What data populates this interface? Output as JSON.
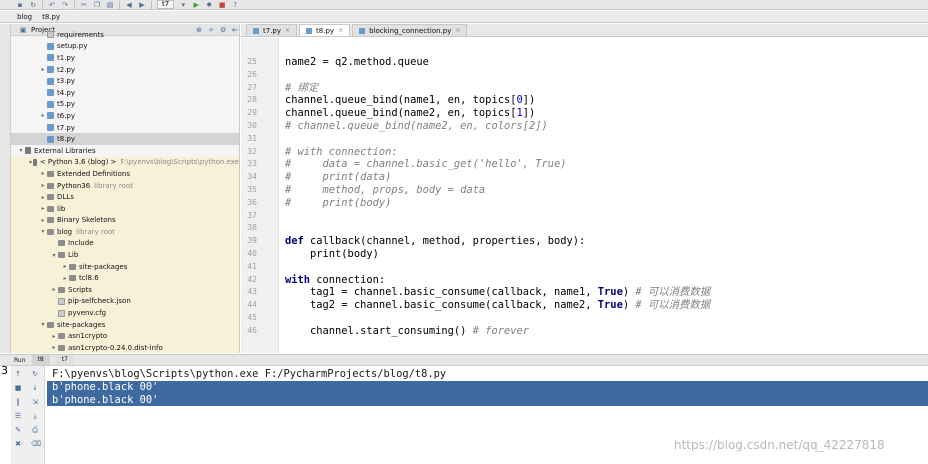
{
  "toolbar": {
    "icons": [
      "save-icon",
      "sync-icon",
      "undo-icon",
      "redo-icon",
      "cut-icon",
      "copy-icon",
      "paste-icon",
      "back-icon",
      "forward-icon",
      "run-config-icon",
      "run-icon",
      "debug-icon",
      "stop-icon",
      "help-icon"
    ],
    "run_config_label": "t7"
  },
  "nav": {
    "crumbs": [
      "blog",
      "t8.py"
    ]
  },
  "project": {
    "header_label": "Project",
    "tree": [
      {
        "label": "requirements",
        "indent": 2,
        "icon": "file",
        "arrow": ""
      },
      {
        "label": "setup.py",
        "indent": 2,
        "icon": "py",
        "arrow": ""
      },
      {
        "label": "t1.py",
        "indent": 2,
        "icon": "py",
        "arrow": ""
      },
      {
        "label": "t2.py",
        "indent": 2,
        "icon": "py",
        "arrow": ">"
      },
      {
        "label": "t3.py",
        "indent": 2,
        "icon": "py",
        "arrow": ""
      },
      {
        "label": "t4.py",
        "indent": 2,
        "icon": "py",
        "arrow": ""
      },
      {
        "label": "t5.py",
        "indent": 2,
        "icon": "py",
        "arrow": ""
      },
      {
        "label": "t6.py",
        "indent": 2,
        "icon": "py",
        "arrow": ">"
      },
      {
        "label": "t7.py",
        "indent": 2,
        "icon": "py",
        "arrow": ""
      },
      {
        "label": "t8.py",
        "indent": 2,
        "icon": "py",
        "arrow": "",
        "selected": true
      },
      {
        "label": "External Libraries",
        "indent": 0,
        "icon": "lib",
        "arrow": "v"
      },
      {
        "label": "< Python 3.6 (blog) >",
        "secondary": "F:\\pyenvs\\blog\\Scripts\\python.exe",
        "indent": 1,
        "icon": "lib",
        "arrow": "v",
        "highlight": true
      },
      {
        "label": "Extended Definitions",
        "indent": 2,
        "icon": "folder",
        "arrow": ">",
        "highlight": true
      },
      {
        "label": "Python36",
        "secondary": "library root",
        "indent": 2,
        "icon": "folder",
        "arrow": ">",
        "highlight": true
      },
      {
        "label": "DLLs",
        "indent": 2,
        "icon": "folder",
        "arrow": ">",
        "highlight": true
      },
      {
        "label": "lib",
        "indent": 2,
        "icon": "folder",
        "arrow": ">",
        "highlight": true
      },
      {
        "label": "Binary Skeletons",
        "indent": 2,
        "icon": "folder",
        "arrow": ">",
        "highlight": true
      },
      {
        "label": "blog",
        "secondary": "library root",
        "indent": 2,
        "icon": "folder",
        "arrow": "v",
        "highlight": true
      },
      {
        "label": "Include",
        "indent": 3,
        "icon": "folder",
        "arrow": "",
        "highlight": true
      },
      {
        "label": "Lib",
        "indent": 3,
        "icon": "folder",
        "arrow": "v",
        "highlight": true
      },
      {
        "label": "site-packages",
        "indent": 4,
        "icon": "folder",
        "arrow": ">",
        "highlight": true
      },
      {
        "label": "tcl8.6",
        "indent": 4,
        "icon": "folder",
        "arrow": ">",
        "highlight": true
      },
      {
        "label": "Scripts",
        "indent": 3,
        "icon": "folder",
        "arrow": ">",
        "highlight": true
      },
      {
        "label": "pip-selfcheck.json",
        "indent": 3,
        "icon": "file",
        "arrow": "",
        "highlight": true
      },
      {
        "label": "pyvenv.cfg",
        "indent": 3,
        "icon": "file",
        "arrow": "",
        "highlight": true
      },
      {
        "label": "site-packages",
        "indent": 2,
        "icon": "folder",
        "arrow": "v",
        "highlight": true
      },
      {
        "label": "asn1crypto",
        "indent": 3,
        "icon": "folder",
        "arrow": ">",
        "highlight": true
      },
      {
        "label": "asn1crypto-0.24.0.dist-info",
        "indent": 3,
        "icon": "folder",
        "arrow": ">",
        "highlight": true
      }
    ]
  },
  "editor": {
    "tabs": [
      {
        "label": "t7.py",
        "active": false
      },
      {
        "label": "t8.py",
        "active": true
      },
      {
        "label": "blocking_connection.py",
        "active": false
      }
    ],
    "lines": [
      {
        "num": "25",
        "code": "name2 = q2.method.queue",
        "cls": ""
      },
      {
        "num": "26",
        "code": "",
        "cls": ""
      },
      {
        "num": "27",
        "code": "# 绑定",
        "cls": "c"
      },
      {
        "num": "28",
        "code": "channel.queue_bind(name1, en, topics[0])",
        "cls": ""
      },
      {
        "num": "29",
        "code": "channel.queue_bind(name2, en, topics[1])",
        "cls": ""
      },
      {
        "num": "30",
        "code": "# channel.queue_bind(name2, en, colors[2])",
        "cls": "c"
      },
      {
        "num": "31",
        "code": "",
        "cls": ""
      },
      {
        "num": "32",
        "code": "# with connection:",
        "cls": "c"
      },
      {
        "num": "33",
        "code": "#     data = channel.basic_get('hello', True)",
        "cls": "c"
      },
      {
        "num": "34",
        "code": "#     print(data)",
        "cls": "c"
      },
      {
        "num": "35",
        "code": "#     method, props, body = data",
        "cls": "c"
      },
      {
        "num": "36",
        "code": "#     print(body)",
        "cls": "c"
      },
      {
        "num": "37",
        "code": "",
        "cls": ""
      },
      {
        "num": "38",
        "code": "",
        "cls": ""
      },
      {
        "num": "39",
        "code": "def callback(channel, method, properties, body):",
        "cls": ""
      },
      {
        "num": "40",
        "code": "    print(body)",
        "cls": ""
      },
      {
        "num": "41",
        "code": "",
        "cls": ""
      },
      {
        "num": "42",
        "code": "with connection:",
        "cls": ""
      },
      {
        "num": "43",
        "code": "    tag1 = channel.basic_consume(callback, name1, True) # 可以消费数据",
        "cls": ""
      },
      {
        "num": "44",
        "code": "    tag2 = channel.basic_consume(callback, name2, True) # 可以消费数据",
        "cls": ""
      },
      {
        "num": "45",
        "code": "",
        "cls": ""
      },
      {
        "num": "46",
        "code": "    channel.start_consuming() # forever",
        "cls": ""
      }
    ]
  },
  "run": {
    "tab_label": "Run",
    "tabs": [
      "t8",
      "t7"
    ],
    "console": [
      {
        "text": "F:\\pyenvs\\blog\\Scripts\\python.exe F:/PycharmProjects/blog/t8.py",
        "selected": false
      },
      {
        "text": "b'phone.black 00'",
        "selected": true
      },
      {
        "text": "b'phone.black 00'",
        "selected": true
      }
    ]
  },
  "side_char": "3",
  "watermark": "https://blog.csdn.net/qq_42227818"
}
